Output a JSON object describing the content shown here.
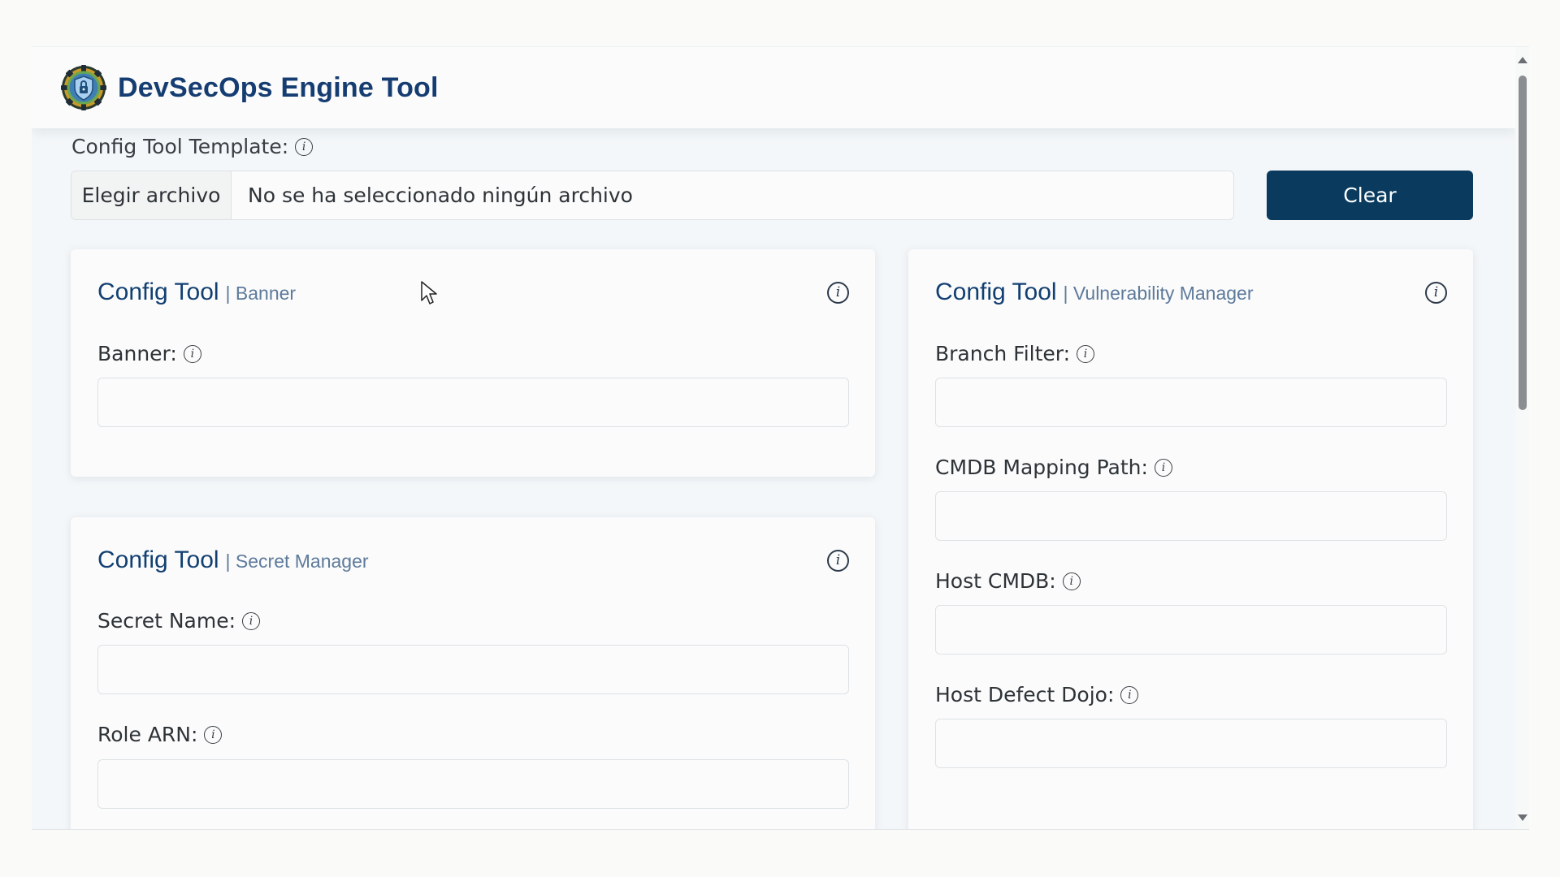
{
  "app": {
    "title": "DevSecOps Engine Tool",
    "logo_icon": "shield-gear-logo-icon"
  },
  "template": {
    "label": "Config Tool Template:",
    "choose_label": "Elegir archivo",
    "file_status": "No se ha seleccionado ningún archivo",
    "clear_label": "Clear"
  },
  "cards": {
    "banner": {
      "title": "Config Tool",
      "subtitle": "| Banner",
      "fields": [
        {
          "label": "Banner:",
          "value": ""
        }
      ]
    },
    "secret": {
      "title": "Config Tool",
      "subtitle": "| Secret Manager",
      "fields": [
        {
          "label": "Secret Name:",
          "value": ""
        },
        {
          "label": "Role ARN:",
          "value": ""
        }
      ]
    },
    "vuln": {
      "title": "Config Tool",
      "subtitle": "| Vulnerability Manager",
      "fields": [
        {
          "label": "Branch Filter:",
          "value": ""
        },
        {
          "label": "CMDB Mapping Path:",
          "value": ""
        },
        {
          "label": "Host CMDB:",
          "value": ""
        },
        {
          "label": "Host Defect Dojo:",
          "value": ""
        }
      ]
    }
  },
  "colors": {
    "accent": "#0a3b5f",
    "title": "#163d72",
    "subtitle": "#5d7a9b"
  },
  "info_icon_glyph": "i"
}
